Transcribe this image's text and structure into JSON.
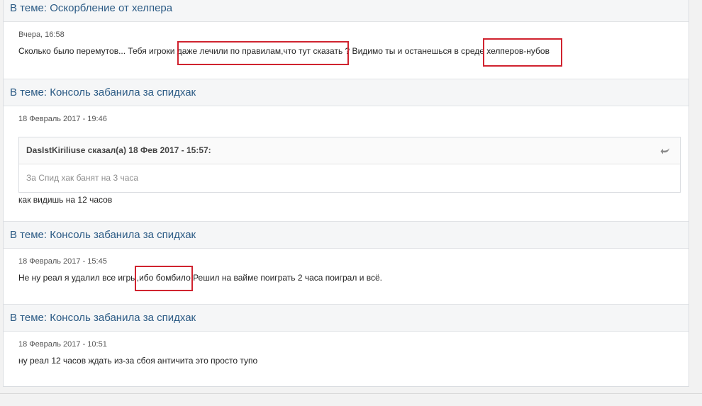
{
  "posts": [
    {
      "topic_prefix": "В теме: ",
      "topic_title": "Оскорбление от хелпера",
      "date": "Вчера, 16:58",
      "text": "Сколько было перемутов... Тебя игроки даже лечили по правилам,что тут сказать ? Видимо ты и останешься в среде хелперов-нубов"
    },
    {
      "topic_prefix": "В теме: ",
      "topic_title": "Консоль забанила за спидхак",
      "date": "18 Февраль 2017 - 19:46",
      "quote": {
        "author_line": "DasIstKiriliuse сказал(а) 18 Фев 2017 - 15:57:",
        "text": "За Спид хак банят на 3 часа"
      },
      "text": "как видишь на 12 часов"
    },
    {
      "topic_prefix": "В теме: ",
      "topic_title": "Консоль забанила за спидхак",
      "date": "18 Февраль 2017 - 15:45",
      "text": "Не ну реал я удалил все игры,ибо бомбило Решил на вайме поиграть 2 часа поиграл и всё."
    },
    {
      "topic_prefix": "В теме: ",
      "topic_title": "Консоль забанила за спидхак",
      "date": "18 Февраль 2017 - 10:51",
      "text": "ну реал 12 часов ждать из-за сбоя античита это просто тупо"
    }
  ],
  "colors": {
    "highlight": "#d0232f",
    "topic_link": "#2c5b85"
  },
  "icons": {
    "quote_icon": "reply-arrow-icon"
  }
}
